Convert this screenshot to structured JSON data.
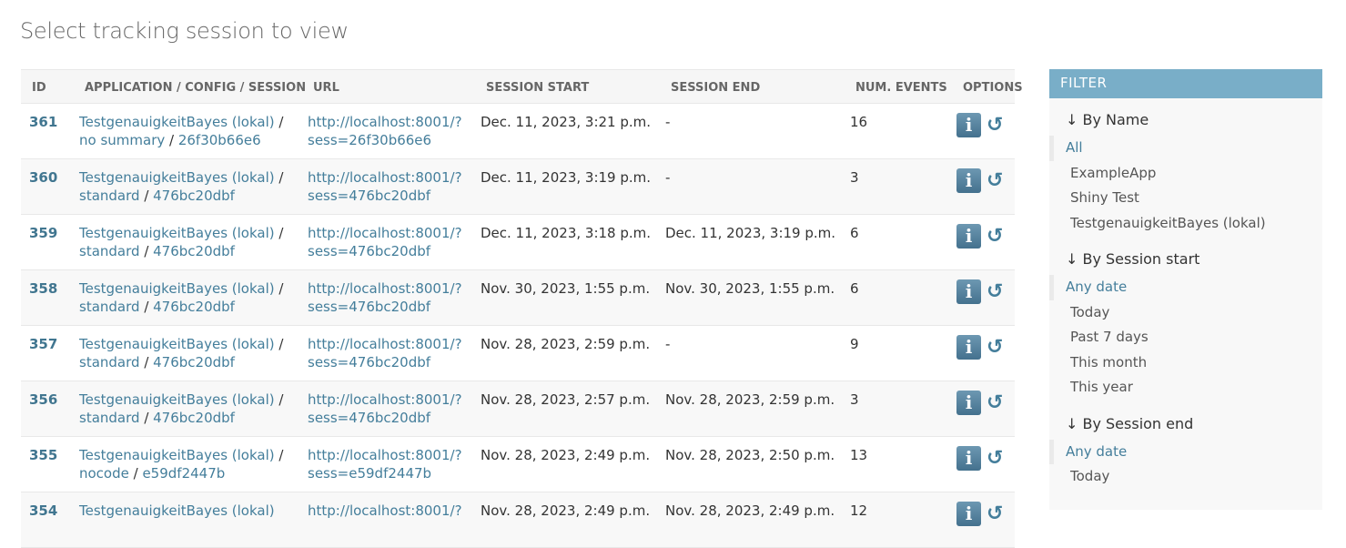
{
  "page": {
    "title": "Select tracking session to view"
  },
  "table": {
    "headers": {
      "id": "ID",
      "app": "APPLICATION / CONFIG / SESSION",
      "url": "URL",
      "start": "SESSION START",
      "end": "SESSION END",
      "num": "NUM. EVENTS",
      "options": "OPTIONS"
    },
    "rows": [
      {
        "id": "361",
        "app": "TestgenauigkeitBayes (lokal)",
        "config": "no summary",
        "session": "26f30b66e6",
        "url1": "http://localhost:8001/?",
        "url2": "sess=26f30b66e6",
        "start": "Dec. 11, 2023, 3:21 p.m.",
        "end": "-",
        "num": "16"
      },
      {
        "id": "360",
        "app": "TestgenauigkeitBayes (lokal)",
        "config": "standard",
        "session": "476bc20dbf",
        "url1": "http://localhost:8001/?",
        "url2": "sess=476bc20dbf",
        "start": "Dec. 11, 2023, 3:19 p.m.",
        "end": "-",
        "num": "3"
      },
      {
        "id": "359",
        "app": "TestgenauigkeitBayes (lokal)",
        "config": "standard",
        "session": "476bc20dbf",
        "url1": "http://localhost:8001/?",
        "url2": "sess=476bc20dbf",
        "start": "Dec. 11, 2023, 3:18 p.m.",
        "end": "Dec. 11, 2023, 3:19 p.m.",
        "num": "6"
      },
      {
        "id": "358",
        "app": "TestgenauigkeitBayes (lokal)",
        "config": "standard",
        "session": "476bc20dbf",
        "url1": "http://localhost:8001/?",
        "url2": "sess=476bc20dbf",
        "start": "Nov. 30, 2023, 1:55 p.m.",
        "end": "Nov. 30, 2023, 1:55 p.m.",
        "num": "6"
      },
      {
        "id": "357",
        "app": "TestgenauigkeitBayes (lokal)",
        "config": "standard",
        "session": "476bc20dbf",
        "url1": "http://localhost:8001/?",
        "url2": "sess=476bc20dbf",
        "start": "Nov. 28, 2023, 2:59 p.m.",
        "end": "-",
        "num": "9"
      },
      {
        "id": "356",
        "app": "TestgenauigkeitBayes (lokal)",
        "config": "standard",
        "session": "476bc20dbf",
        "url1": "http://localhost:8001/?",
        "url2": "sess=476bc20dbf",
        "start": "Nov. 28, 2023, 2:57 p.m.",
        "end": "Nov. 28, 2023, 2:59 p.m.",
        "num": "3"
      },
      {
        "id": "355",
        "app": "TestgenauigkeitBayes (lokal)",
        "config": "nocode",
        "session": "e59df2447b",
        "url1": "http://localhost:8001/?",
        "url2": "sess=e59df2447b",
        "start": "Nov. 28, 2023, 2:49 p.m.",
        "end": "Nov. 28, 2023, 2:50 p.m.",
        "num": "13"
      },
      {
        "id": "354",
        "app": "TestgenauigkeitBayes (lokal)",
        "config": "",
        "session": "",
        "url1": "http://localhost:8001/?",
        "url2": "",
        "start": "Nov. 28, 2023, 2:49 p.m.",
        "end": "Nov. 28, 2023, 2:49 p.m.",
        "num": "12"
      }
    ],
    "separator": " / ",
    "options_icons": {
      "info": "info-icon",
      "replay": "replay-icon"
    },
    "info_glyph": "i",
    "replay_glyph": "↺"
  },
  "filter": {
    "header": "FILTER",
    "groups": [
      {
        "title": "↓ By Name",
        "options": [
          "All",
          "ExampleApp",
          "Shiny Test",
          "TestgenauigkeitBayes (lokal)"
        ],
        "selected": 0
      },
      {
        "title": "↓ By Session start",
        "options": [
          "Any date",
          "Today",
          "Past 7 days",
          "This month",
          "This year"
        ],
        "selected": 0
      },
      {
        "title": "↓ By Session end",
        "options": [
          "Any date",
          "Today"
        ],
        "selected": 0
      }
    ]
  },
  "colors": {
    "link": "#447e9b",
    "filter_header": "#79aec8",
    "info_button": "#5a87a3"
  }
}
